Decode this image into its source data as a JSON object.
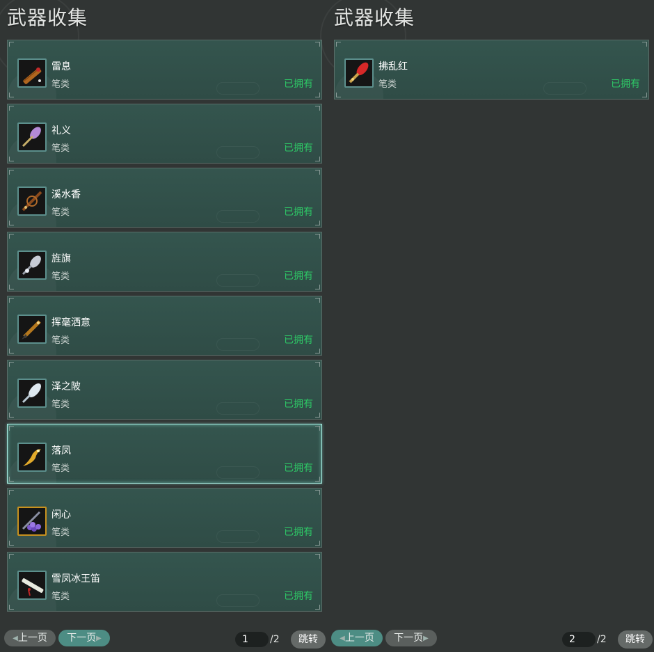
{
  "left": {
    "title": "武器收集",
    "items": [
      {
        "name": "雷息",
        "kind": "笔类",
        "status": "已拥有",
        "icon": "bamboo-flute-brush-icon"
      },
      {
        "name": "礼义",
        "kind": "笔类",
        "status": "已拥有",
        "icon": "purple-brush-icon"
      },
      {
        "name": "溪水香",
        "kind": "笔类",
        "status": "已拥有",
        "icon": "ornate-brush-icon"
      },
      {
        "name": "旌旗",
        "kind": "笔类",
        "status": "已拥有",
        "icon": "silver-brush-icon"
      },
      {
        "name": "挥毫洒意",
        "kind": "笔类",
        "status": "已拥有",
        "icon": "golden-brush-icon"
      },
      {
        "name": "泽之陂",
        "kind": "笔类",
        "status": "已拥有",
        "icon": "ice-brush-icon"
      },
      {
        "name": "落凤",
        "kind": "笔类",
        "status": "已拥有",
        "icon": "phoenix-brush-icon"
      },
      {
        "name": "闲心",
        "kind": "笔类",
        "status": "已拥有",
        "icon": "grape-brush-icon"
      },
      {
        "name": "雪凤冰王笛",
        "kind": "笔类",
        "status": "已拥有",
        "icon": "jade-flute-icon"
      }
    ],
    "pager": {
      "prev": "上一页",
      "next": "下一页",
      "current": "1",
      "total": "/2",
      "jump": "跳转"
    }
  },
  "right": {
    "title": "武器收集",
    "items": [
      {
        "name": "拂乱红",
        "kind": "笔类",
        "status": "已拥有",
        "icon": "red-brush-icon"
      }
    ],
    "pager": {
      "prev": "上一页",
      "next": "下一页",
      "current": "2",
      "total": "/2",
      "jump": "跳转"
    }
  },
  "colors": {
    "owned": "#2ec866",
    "card": "#33524c",
    "background": "#313534"
  }
}
